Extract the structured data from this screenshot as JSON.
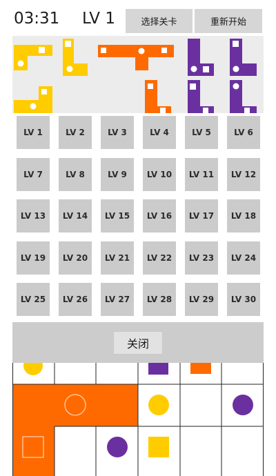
{
  "header": {
    "timer": "03:31",
    "level": "LV 1",
    "select_level_label": "选择关卡",
    "restart_label": "重新开始"
  },
  "colors": {
    "yellow": "#ffcc00",
    "orange": "#ff6a00",
    "purple": "#6a30a0",
    "tray_bg": "#ececec",
    "button_bg": "#cbcbcb"
  },
  "level_select": {
    "levels": [
      "LV 1",
      "LV 2",
      "LV 3",
      "LV 4",
      "LV 5",
      "LV 6",
      "LV 7",
      "LV 8",
      "LV 9",
      "LV 10",
      "LV 11",
      "LV 12",
      "LV 13",
      "LV 14",
      "LV 15",
      "LV 16",
      "LV 17",
      "LV 18",
      "LV 19",
      "LV 20",
      "LV 21",
      "LV 22",
      "LV 23",
      "LV 24",
      "LV 25",
      "LV 26",
      "LV 27",
      "LV 28",
      "LV 29",
      "LV 30"
    ],
    "close_label": "关闭"
  },
  "tray_pieces": [
    {
      "name": "yellow-piece-1",
      "color": "yellow"
    },
    {
      "name": "yellow-piece-2",
      "color": "yellow"
    },
    {
      "name": "orange-piece-1",
      "color": "orange"
    },
    {
      "name": "purple-piece-1",
      "color": "purple"
    },
    {
      "name": "purple-piece-2",
      "color": "purple"
    },
    {
      "name": "yellow-piece-3",
      "color": "yellow"
    },
    {
      "name": "orange-piece-2",
      "color": "orange"
    },
    {
      "name": "purple-piece-3",
      "color": "purple"
    },
    {
      "name": "purple-piece-4",
      "color": "purple"
    }
  ]
}
